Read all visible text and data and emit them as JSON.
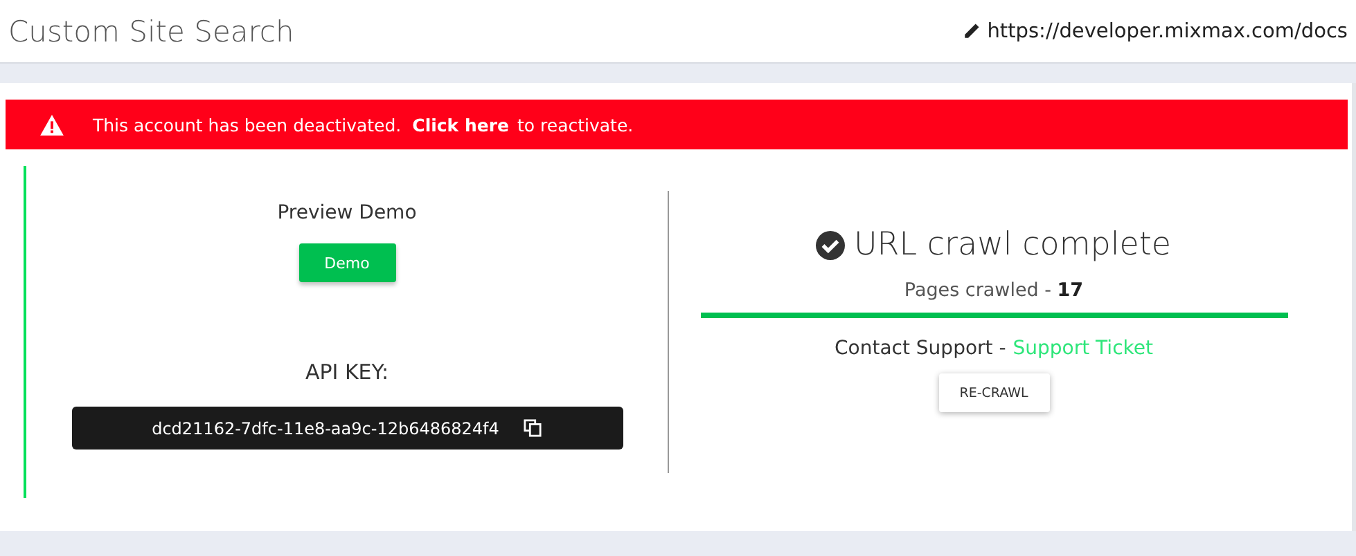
{
  "header": {
    "title": "Custom Site Search",
    "url": "https://developer.mixmax.com/docs"
  },
  "alert": {
    "message": "This account has been deactivated.",
    "link": "Click here",
    "suffix": "to reactivate."
  },
  "preview": {
    "heading": "Preview Demo",
    "button": "Demo"
  },
  "api_key": {
    "label": "API KEY:",
    "value": "dcd21162-7dfc-11e8-aa9c-12b6486824f4"
  },
  "crawl": {
    "status": "URL crawl complete",
    "pages": "Pages crawled - **17**",
    "level": 1,
    "contact": "Contact Support -",
    "support_link": "Support Ticket",
    "button": "RE-CRAWL"
  }
}
